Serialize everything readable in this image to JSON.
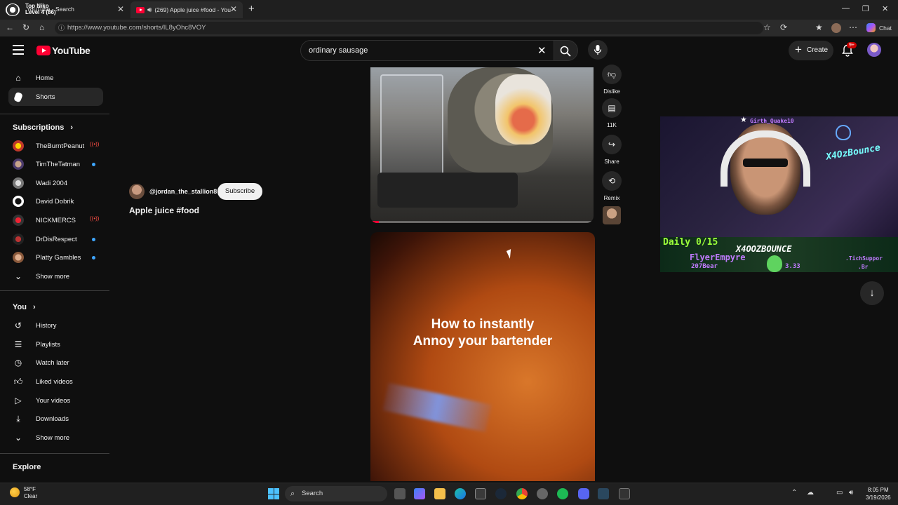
{
  "browser": {
    "tabs": [
      {
        "label": "YouTube - Search",
        "overlay_line1": "Top Niko",
        "overlay_line2": "Level 4 (86)"
      },
      {
        "label": "(269) Apple juice #food - You",
        "active": true
      }
    ],
    "url": "https://www.youtube.com/shorts/IL8yOhc8VOY",
    "chat_label": "Chat",
    "new_tab": "+"
  },
  "header": {
    "logo_text": "YouTube",
    "search_value": "ordinary sausage",
    "create_label": "Create",
    "notification_badge": "9+"
  },
  "sidebar": {
    "main": [
      {
        "label": "Home",
        "icon": "home-icon"
      },
      {
        "label": "Shorts",
        "icon": "shorts-icon",
        "active": true
      }
    ],
    "subscriptions_title": "Subscriptions",
    "subscriptions": [
      {
        "label": "TheBurntPeanut",
        "status": "live"
      },
      {
        "label": "TimTheTatman",
        "status": "new"
      },
      {
        "label": "Wadi 2004",
        "status": ""
      },
      {
        "label": "David Dobrik",
        "status": ""
      },
      {
        "label": "NICKMERCS",
        "status": "live"
      },
      {
        "label": "DrDisRespect",
        "status": "new"
      },
      {
        "label": "Platty Gambles",
        "status": "new"
      }
    ],
    "show_more_1": "Show more",
    "you_title": "You",
    "you_items": [
      {
        "label": "History",
        "icon": "history-icon"
      },
      {
        "label": "Playlists",
        "icon": "playlists-icon"
      },
      {
        "label": "Watch later",
        "icon": "clock-icon"
      },
      {
        "label": "Liked videos",
        "icon": "like-icon"
      },
      {
        "label": "Your videos",
        "icon": "video-icon"
      },
      {
        "label": "Downloads",
        "icon": "download-icon"
      }
    ],
    "show_more_2": "Show more",
    "explore_title": "Explore"
  },
  "short": {
    "channel": "@jordan_the_stallion8",
    "subscribe_label": "Subscribe",
    "title": "Apple juice #food",
    "actions": {
      "dislike": "Dislike",
      "comments": "11K",
      "share": "Share",
      "remix": "Remix"
    },
    "next_caption_line1": "How to instantly",
    "next_caption_line2": "Annoy your bartender"
  },
  "stream_overlay": {
    "username": "Girth_Quake10",
    "daily": "Daily 0/15",
    "handle": "X4OOZBOUNCE",
    "sponsor": "FlyerEmpyre",
    "viewer": "207Bear",
    "amount": "3.33",
    "neon_sign": "X4OzBounce",
    "ticker_1": ".TichSuppor",
    "ticker_2": ".Br"
  },
  "taskbar": {
    "temperature": "58°F",
    "weather": "Clear",
    "search_label": "Search",
    "time": "8:05 PM",
    "date": "3/19/2026"
  }
}
